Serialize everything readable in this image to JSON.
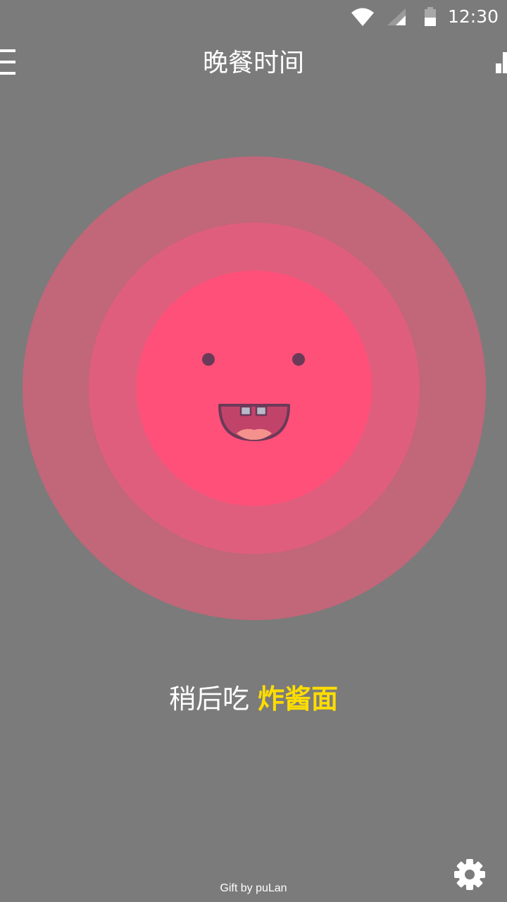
{
  "status_bar": {
    "time": "12:30",
    "icons": [
      "wifi-icon",
      "signal-icon",
      "battery-icon"
    ]
  },
  "app_bar": {
    "title": "晚餐时间",
    "left_icon": "menu-icon",
    "right_icon": "bar-chart-icon"
  },
  "result": {
    "prefix": "稍后吃",
    "dish": "炸酱面"
  },
  "footer": {
    "credit": "Gift by puLan",
    "settings_icon": "gear-icon"
  },
  "colors": {
    "background": "#7b7b7b",
    "outer_circle": "#c26679",
    "middle_circle": "#e05e7d",
    "inner_circle": "#ff5079",
    "accent_text": "#ffdd00",
    "face_stroke": "#6b3a58"
  }
}
